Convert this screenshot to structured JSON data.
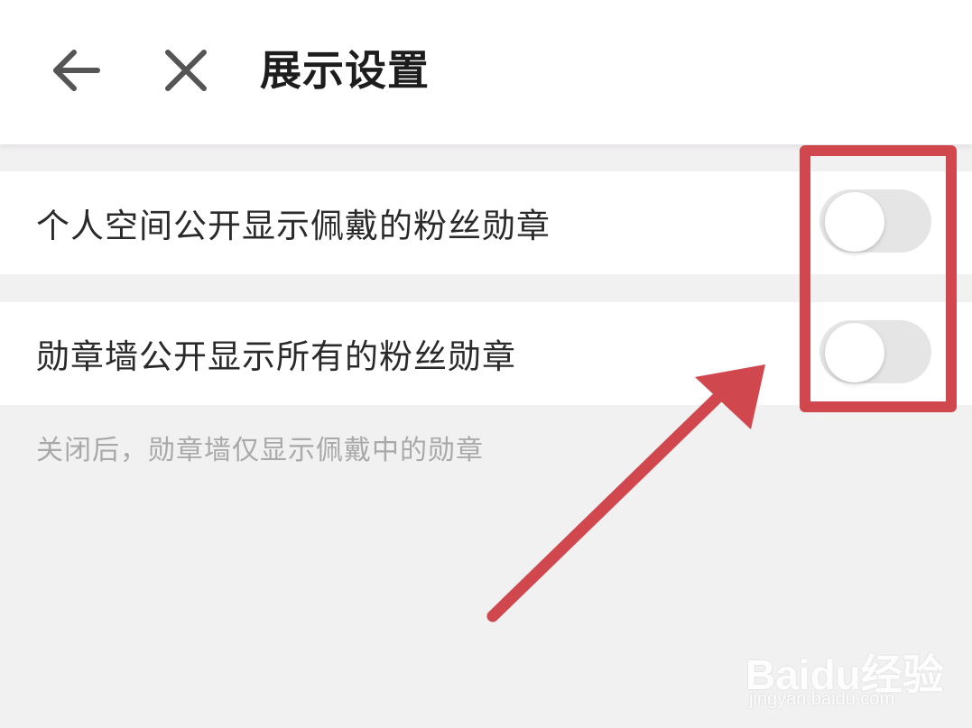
{
  "header": {
    "title": "展示设置",
    "back_icon": "arrow-left-icon",
    "close_icon": "close-icon"
  },
  "settings": [
    {
      "label": "个人空间公开显示佩戴的粉丝勋章",
      "enabled": false
    },
    {
      "label": "勋章墙公开显示所有的粉丝勋章",
      "enabled": false
    }
  ],
  "hint": "关闭后，勋章墙仅显示佩戴中的勋章",
  "annotation": {
    "color": "#d0474d"
  },
  "watermark": {
    "brand": "Baidu经验",
    "url": "jingyan.baidu.com"
  },
  "colors": {
    "background": "#f2f1f2",
    "toggle_off": "#e6e5e6",
    "hint_text": "#a9a9a9"
  }
}
